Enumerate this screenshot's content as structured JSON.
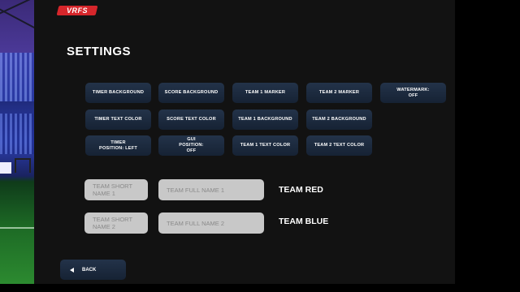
{
  "app": {
    "logo_text": "VRFS"
  },
  "page": {
    "title": "SETTINGS"
  },
  "buttons": {
    "timer_background": "TIMER BACKGROUND",
    "score_background": "SCORE BACKGROUND",
    "team1_marker": "TEAM 1 MARKER",
    "team2_marker": "TEAM 2 MARKER",
    "watermark": "WATERMARK: OFF",
    "timer_text_color": "TIMER TEXT COLOR",
    "score_text_color": "SCORE TEXT COLOR",
    "team1_background": "TEAM 1 BACKGROUND",
    "team2_background": "TEAM 2 BACKGROUND",
    "timer_position": "TIMER POSITION: LEFT",
    "gui_position": "GUI POSITION: OFF",
    "team1_text_color": "TEAM 1 TEXT COLOR",
    "team2_text_color": "TEAM 2 TEXT COLOR",
    "back": "BACK"
  },
  "teams": [
    {
      "short_placeholder": "TEAM SHORT NAME 1",
      "full_placeholder": "TEAM FULL NAME 1",
      "label": "TEAM RED"
    },
    {
      "short_placeholder": "TEAM SHORT NAME 2",
      "full_placeholder": "TEAM FULL NAME 2",
      "label": "TEAM BLUE"
    }
  ],
  "colors": {
    "accent": "#d6262b",
    "button": "#1d2b3f",
    "panel": "#121212"
  }
}
